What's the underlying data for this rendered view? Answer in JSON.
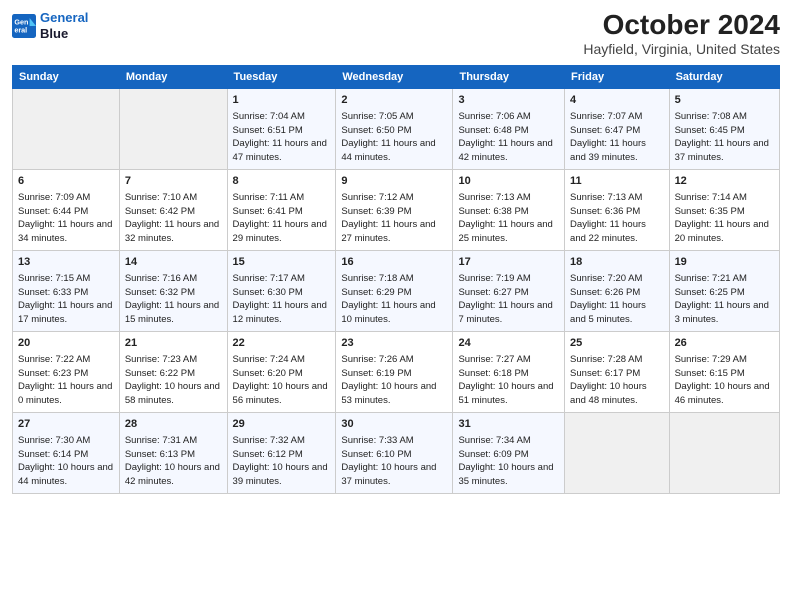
{
  "logo": {
    "line1": "General",
    "line2": "Blue"
  },
  "title": "October 2024",
  "subtitle": "Hayfield, Virginia, United States",
  "days_of_week": [
    "Sunday",
    "Monday",
    "Tuesday",
    "Wednesday",
    "Thursday",
    "Friday",
    "Saturday"
  ],
  "weeks": [
    [
      {
        "day": "",
        "info": ""
      },
      {
        "day": "",
        "info": ""
      },
      {
        "day": "1",
        "info": "Sunrise: 7:04 AM\nSunset: 6:51 PM\nDaylight: 11 hours and 47 minutes."
      },
      {
        "day": "2",
        "info": "Sunrise: 7:05 AM\nSunset: 6:50 PM\nDaylight: 11 hours and 44 minutes."
      },
      {
        "day": "3",
        "info": "Sunrise: 7:06 AM\nSunset: 6:48 PM\nDaylight: 11 hours and 42 minutes."
      },
      {
        "day": "4",
        "info": "Sunrise: 7:07 AM\nSunset: 6:47 PM\nDaylight: 11 hours and 39 minutes."
      },
      {
        "day": "5",
        "info": "Sunrise: 7:08 AM\nSunset: 6:45 PM\nDaylight: 11 hours and 37 minutes."
      }
    ],
    [
      {
        "day": "6",
        "info": "Sunrise: 7:09 AM\nSunset: 6:44 PM\nDaylight: 11 hours and 34 minutes."
      },
      {
        "day": "7",
        "info": "Sunrise: 7:10 AM\nSunset: 6:42 PM\nDaylight: 11 hours and 32 minutes."
      },
      {
        "day": "8",
        "info": "Sunrise: 7:11 AM\nSunset: 6:41 PM\nDaylight: 11 hours and 29 minutes."
      },
      {
        "day": "9",
        "info": "Sunrise: 7:12 AM\nSunset: 6:39 PM\nDaylight: 11 hours and 27 minutes."
      },
      {
        "day": "10",
        "info": "Sunrise: 7:13 AM\nSunset: 6:38 PM\nDaylight: 11 hours and 25 minutes."
      },
      {
        "day": "11",
        "info": "Sunrise: 7:13 AM\nSunset: 6:36 PM\nDaylight: 11 hours and 22 minutes."
      },
      {
        "day": "12",
        "info": "Sunrise: 7:14 AM\nSunset: 6:35 PM\nDaylight: 11 hours and 20 minutes."
      }
    ],
    [
      {
        "day": "13",
        "info": "Sunrise: 7:15 AM\nSunset: 6:33 PM\nDaylight: 11 hours and 17 minutes."
      },
      {
        "day": "14",
        "info": "Sunrise: 7:16 AM\nSunset: 6:32 PM\nDaylight: 11 hours and 15 minutes."
      },
      {
        "day": "15",
        "info": "Sunrise: 7:17 AM\nSunset: 6:30 PM\nDaylight: 11 hours and 12 minutes."
      },
      {
        "day": "16",
        "info": "Sunrise: 7:18 AM\nSunset: 6:29 PM\nDaylight: 11 hours and 10 minutes."
      },
      {
        "day": "17",
        "info": "Sunrise: 7:19 AM\nSunset: 6:27 PM\nDaylight: 11 hours and 7 minutes."
      },
      {
        "day": "18",
        "info": "Sunrise: 7:20 AM\nSunset: 6:26 PM\nDaylight: 11 hours and 5 minutes."
      },
      {
        "day": "19",
        "info": "Sunrise: 7:21 AM\nSunset: 6:25 PM\nDaylight: 11 hours and 3 minutes."
      }
    ],
    [
      {
        "day": "20",
        "info": "Sunrise: 7:22 AM\nSunset: 6:23 PM\nDaylight: 11 hours and 0 minutes."
      },
      {
        "day": "21",
        "info": "Sunrise: 7:23 AM\nSunset: 6:22 PM\nDaylight: 10 hours and 58 minutes."
      },
      {
        "day": "22",
        "info": "Sunrise: 7:24 AM\nSunset: 6:20 PM\nDaylight: 10 hours and 56 minutes."
      },
      {
        "day": "23",
        "info": "Sunrise: 7:26 AM\nSunset: 6:19 PM\nDaylight: 10 hours and 53 minutes."
      },
      {
        "day": "24",
        "info": "Sunrise: 7:27 AM\nSunset: 6:18 PM\nDaylight: 10 hours and 51 minutes."
      },
      {
        "day": "25",
        "info": "Sunrise: 7:28 AM\nSunset: 6:17 PM\nDaylight: 10 hours and 48 minutes."
      },
      {
        "day": "26",
        "info": "Sunrise: 7:29 AM\nSunset: 6:15 PM\nDaylight: 10 hours and 46 minutes."
      }
    ],
    [
      {
        "day": "27",
        "info": "Sunrise: 7:30 AM\nSunset: 6:14 PM\nDaylight: 10 hours and 44 minutes."
      },
      {
        "day": "28",
        "info": "Sunrise: 7:31 AM\nSunset: 6:13 PM\nDaylight: 10 hours and 42 minutes."
      },
      {
        "day": "29",
        "info": "Sunrise: 7:32 AM\nSunset: 6:12 PM\nDaylight: 10 hours and 39 minutes."
      },
      {
        "day": "30",
        "info": "Sunrise: 7:33 AM\nSunset: 6:10 PM\nDaylight: 10 hours and 37 minutes."
      },
      {
        "day": "31",
        "info": "Sunrise: 7:34 AM\nSunset: 6:09 PM\nDaylight: 10 hours and 35 minutes."
      },
      {
        "day": "",
        "info": ""
      },
      {
        "day": "",
        "info": ""
      }
    ]
  ]
}
